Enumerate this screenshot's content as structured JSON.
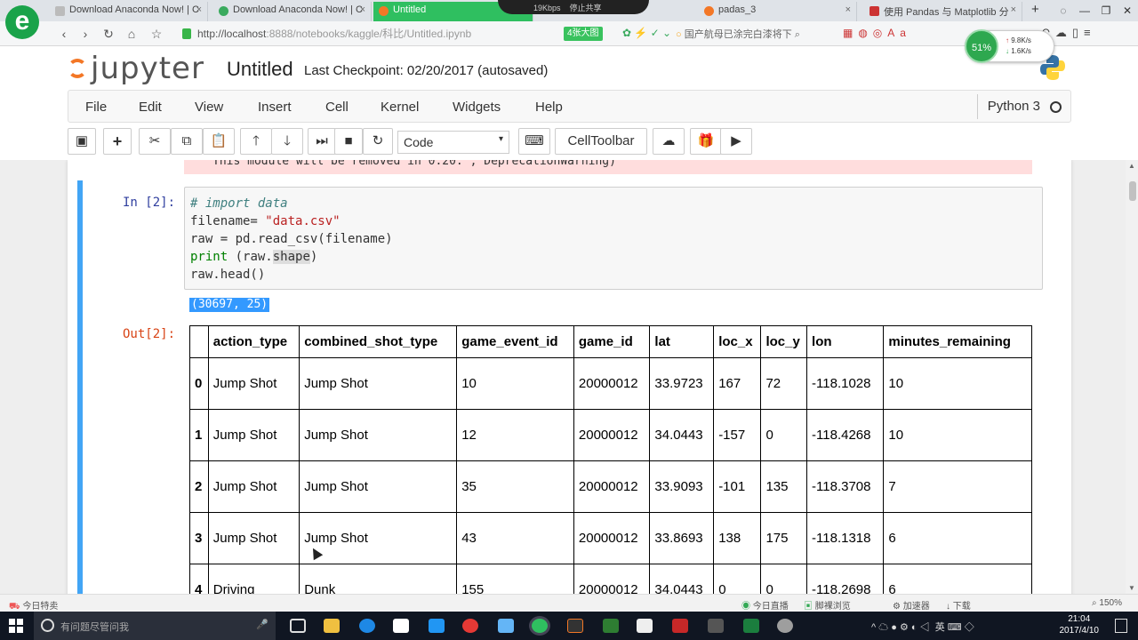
{
  "browser": {
    "tabs": [
      {
        "title": "Download Anaconda Now! | C",
        "close": "×"
      },
      {
        "title": "Download Anaconda Now! | C",
        "close": "×"
      },
      {
        "title": "Untitled",
        "close": ""
      },
      {
        "title": "19Kbps",
        "close": ""
      },
      {
        "title": "停止共享",
        "close": ""
      },
      {
        "title": "padas_3",
        "close": "×"
      },
      {
        "title": "使用 Pandas 与 Matplotlib 分",
        "close": "×"
      }
    ],
    "new_tab": "+",
    "url_host": "http://localhost",
    "url_path": ":8888/notebooks/kaggle/科比/Untitled.ipynb",
    "badge": "4张大图",
    "news": "国产航母已涂完白漆将下",
    "net_percent": "51%",
    "net_up": "9.8K/s",
    "net_down": "1.6K/s"
  },
  "jupyter": {
    "logo_text": "jupyter",
    "notebook_title": "Untitled",
    "checkpoint": "Last Checkpoint: 02/20/2017 (autosaved)",
    "menu": [
      "File",
      "Edit",
      "View",
      "Insert",
      "Cell",
      "Kernel",
      "Widgets",
      "Help"
    ],
    "kernel": "Python 3",
    "cell_type": "Code",
    "celltoolbar": "CellToolbar"
  },
  "notebook": {
    "warning_text": "This module will be removed in 0.20.\", DeprecationWarning)",
    "in_prompt": "In [2]:",
    "out_prompt": "Out[2]:",
    "code": {
      "line1": "# import data",
      "line2_a": "filename= ",
      "line2_b": "\"data.csv\"",
      "line3": "raw = pd.read_csv(filename)",
      "line4_a": "print",
      "line4_b": " (raw.",
      "line4_c": "shape",
      "line4_d": ")",
      "line5": "raw.head()"
    },
    "stdout": "(30697, 25)",
    "table": {
      "columns": [
        "",
        "action_type",
        "combined_shot_type",
        "game_event_id",
        "game_id",
        "lat",
        "loc_x",
        "loc_y",
        "lon",
        "minutes_remaining"
      ],
      "rows": [
        [
          "0",
          "Jump Shot",
          "Jump Shot",
          "10",
          "20000012",
          "33.9723",
          "167",
          "72",
          "-118.1028",
          "10"
        ],
        [
          "1",
          "Jump Shot",
          "Jump Shot",
          "12",
          "20000012",
          "34.0443",
          "-157",
          "0",
          "-118.4268",
          "10"
        ],
        [
          "2",
          "Jump Shot",
          "Jump Shot",
          "35",
          "20000012",
          "33.9093",
          "-101",
          "135",
          "-118.3708",
          "7"
        ],
        [
          "3",
          "Jump Shot",
          "Jump Shot",
          "43",
          "20000012",
          "33.8693",
          "138",
          "175",
          "-118.1318",
          "6"
        ],
        [
          "4",
          "Driving",
          "Dunk",
          "155",
          "20000012",
          "34.0443",
          "0",
          "0",
          "-118.2698",
          "6"
        ]
      ]
    }
  },
  "statusbar": {
    "left": "今日特卖",
    "items": [
      "今日直播",
      "脚裸浏览",
      "加速器",
      "下载",
      "150%"
    ]
  },
  "taskbar": {
    "search_placeholder": "有问题尽管问我",
    "tray_lang": "英",
    "time": "21:04",
    "date": "2017/4/10"
  },
  "colors": {
    "accent_blue": "#42a5f5",
    "in_prompt": "#303f9f",
    "out_prompt": "#d84315",
    "warning_bg": "#ffdddd"
  }
}
